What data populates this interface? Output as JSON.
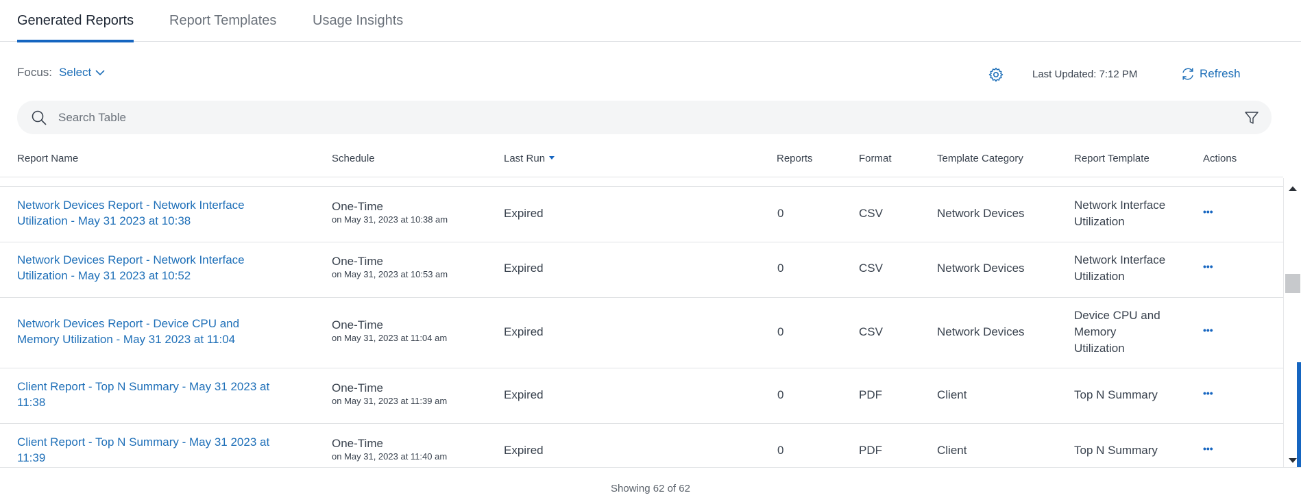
{
  "tabs": [
    {
      "label": "Generated Reports",
      "active": true
    },
    {
      "label": "Report Templates",
      "active": false
    },
    {
      "label": "Usage Insights",
      "active": false
    }
  ],
  "toolbar": {
    "focus_label": "Focus:",
    "focus_value": "Select",
    "settings_icon": "gear-icon",
    "last_updated": "Last Updated: 7:12 PM",
    "refresh_label": "Refresh"
  },
  "search": {
    "placeholder": "Search Table",
    "value": ""
  },
  "table": {
    "columns": [
      "Report Name",
      "Schedule",
      "Last Run",
      "Reports",
      "Format",
      "Template Category",
      "Report Template",
      "Actions"
    ],
    "sorted_column": "Last Run",
    "rows": [
      {
        "name_line1": "Network Devices Report - Network Interface",
        "name_line2": "Utilization - May 31 2023 at 10:38",
        "schedule": "One-Time",
        "schedule_detail": "on May 31, 2023 at 10:38 am",
        "last_run": "Expired",
        "reports": "0",
        "format": "CSV",
        "category": "Network Devices",
        "template": [
          "Network Interface",
          "Utilization"
        ],
        "actions": "•••"
      },
      {
        "name_line1": "Network Devices Report - Network Interface",
        "name_line2": "Utilization - May 31 2023 at 10:52",
        "schedule": "One-Time",
        "schedule_detail": "on May 31, 2023 at 10:53 am",
        "last_run": "Expired",
        "reports": "0",
        "format": "CSV",
        "category": "Network Devices",
        "template": [
          "Network Interface",
          "Utilization"
        ],
        "actions": "•••"
      },
      {
        "name_line1": "Network Devices Report - Device CPU and",
        "name_line2": "Memory Utilization - May 31 2023 at 11:04",
        "schedule": "One-Time",
        "schedule_detail": "on May 31, 2023 at 11:04 am",
        "last_run": "Expired",
        "reports": "0",
        "format": "CSV",
        "category": "Network Devices",
        "template": [
          "Device CPU and",
          "Memory",
          "Utilization"
        ],
        "actions": "•••"
      },
      {
        "name_line1": "Client Report - Top N Summary - May 31 2023 at",
        "name_line2": "11:38",
        "schedule": "One-Time",
        "schedule_detail": "on May 31, 2023 at 11:39 am",
        "last_run": "Expired",
        "reports": "0",
        "format": "PDF",
        "category": "Client",
        "template": [
          "Top N Summary"
        ],
        "actions": "•••"
      },
      {
        "name_line1": "Client Report - Top N Summary - May 31 2023 at",
        "name_line2": "11:39",
        "schedule": "One-Time",
        "schedule_detail": "on May 31, 2023 at 11:40 am",
        "last_run": "Expired",
        "reports": "0",
        "format": "PDF",
        "category": "Client",
        "template": [
          "Top N Summary"
        ],
        "actions": "•••"
      }
    ]
  },
  "footer": {
    "showing": "Showing 62 of 62"
  }
}
